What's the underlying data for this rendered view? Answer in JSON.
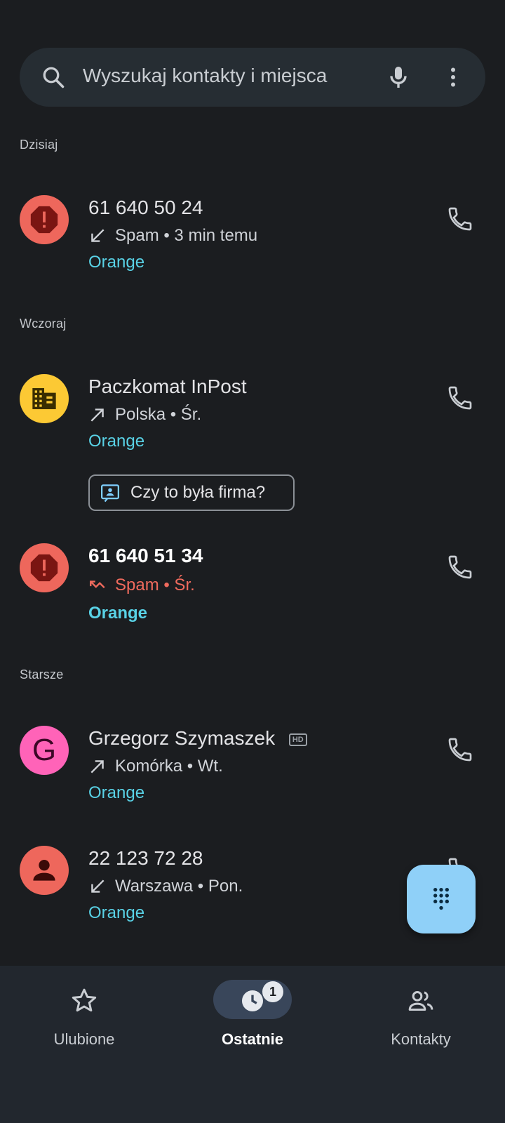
{
  "search": {
    "placeholder": "Wyszukaj kontakty i miejsca"
  },
  "sections": {
    "today": "Dzisiaj",
    "yesterday": "Wczoraj",
    "older": "Starsze"
  },
  "calls": [
    {
      "name": "61 640 50 24",
      "direction": "incoming",
      "detail": "Spam • 3 min temu",
      "carrier": "Orange",
      "avatar": "spam-warning",
      "avatar_color": "#ee675c"
    },
    {
      "name": "Paczkomat InPost",
      "direction": "outgoing",
      "detail": "Polska • Śr.",
      "carrier": "Orange",
      "avatar": "business",
      "avatar_color": "#fcc934"
    },
    {
      "name": "61 640 51 34",
      "direction": "missed",
      "detail": "Spam • Śr.",
      "carrier": "Orange",
      "avatar": "spam-warning",
      "avatar_color": "#ee675c"
    },
    {
      "name": "Grzegorz Szymaszek",
      "hd": "HD",
      "direction": "outgoing",
      "detail": "Komórka • Wt.",
      "carrier": "Orange",
      "avatar": "G",
      "avatar_color": "#ff63b8"
    },
    {
      "name": "22 123 72 28",
      "direction": "incoming",
      "detail": "Warszawa • Pon.",
      "carrier": "Orange",
      "avatar": "person",
      "avatar_color": "#ee675c"
    }
  ],
  "business_chip": {
    "label": "Czy to była firma?"
  },
  "nav": {
    "items": [
      {
        "label": "Ulubione",
        "icon": "star-icon"
      },
      {
        "label": "Ostatnie",
        "icon": "recents-icon",
        "active": true,
        "badge": "1"
      },
      {
        "label": "Kontakty",
        "icon": "contacts-icon"
      }
    ]
  },
  "colors": {
    "background": "#1b1d20",
    "carrier": "#59d2e6",
    "spam": "#f06a5d",
    "fab": "#8fd0f8"
  }
}
